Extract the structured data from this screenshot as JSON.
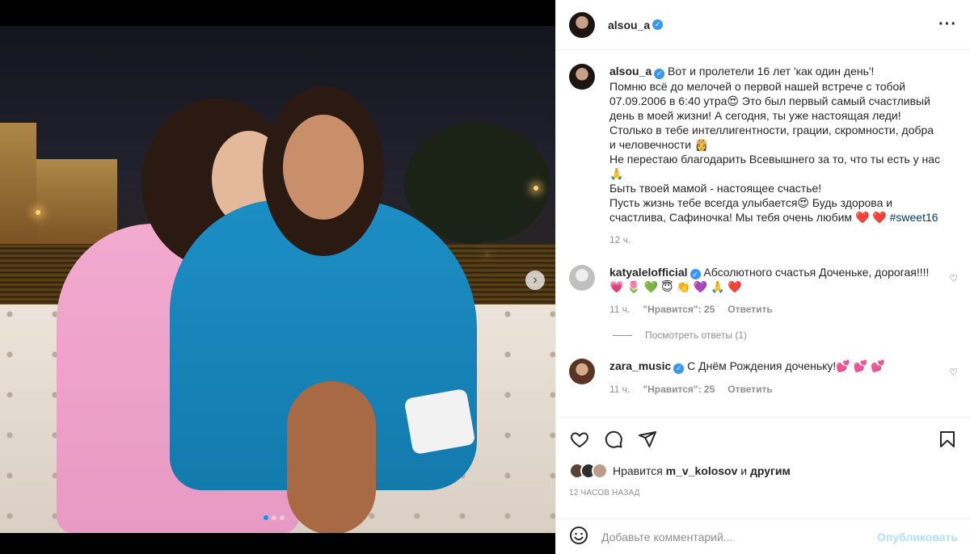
{
  "post": {
    "author": "alsou_a",
    "more_icon": "more-horizontal-icon"
  },
  "caption": {
    "author": "alsou_a",
    "lines": [
      "Вот и пролетели 16 лет 'как один день'!",
      "Помню всё до мелочей о первой нашей встрече с тобой",
      "07.09.2006 в 6:40 утра😍 Это был первый самый счастливый",
      "день в моей жизни! А сегодня, ты уже настоящая леди!",
      "Столько в тебе интеллигентности, грации, скромности, добра",
      "и человечности 👸",
      "Не перестаю благодарить Всевышнего за то, что ты есть у нас",
      "🙏",
      "Быть твоей мамой - настоящее счастье!",
      "Пусть жизнь тебе всегда улыбается😍 Будь здорова и",
      "счастлива, Сафиночка! Мы тебя очень любим"
    ],
    "hearts": "❤️ ❤️",
    "hashtag": "#sweet16",
    "time": "12 ч."
  },
  "comments": [
    {
      "author": "katyalelofficial",
      "text": "Абсолютного счастья Доченьке, дорогая!!!!",
      "emojis": "💗 🌷 💚 😇 👏 💜 🙏 ❤️",
      "time": "11 ч.",
      "likes": "\"Нравится\": 25",
      "reply": "Ответить",
      "view_replies": "Посмотреть ответы (1)"
    },
    {
      "author": "zara_music",
      "text": "С Днём Рождения доченьку!💕 💕 💕",
      "time": "11 ч.",
      "likes": "\"Нравится\": 25",
      "reply": "Ответить"
    }
  ],
  "actions": {
    "like_icon": "heart-icon",
    "comment_icon": "comment-icon",
    "share_icon": "share-icon",
    "save_icon": "bookmark-icon"
  },
  "likes": {
    "prefix": "Нравится",
    "user": "m_v_kolosov",
    "middle": "и",
    "suffix": "другим"
  },
  "timestamp": "12 часов назад",
  "add_comment": {
    "placeholder": "Добавьте комментарий...",
    "publish": "Опубликовать"
  },
  "carousel": {
    "dot_count": 3,
    "active_index": 0
  },
  "colors": {
    "accent": "#0095f6",
    "verified": "#3897f0",
    "like_red": "#ed4956",
    "publish_disabled": "#b2dffc"
  }
}
